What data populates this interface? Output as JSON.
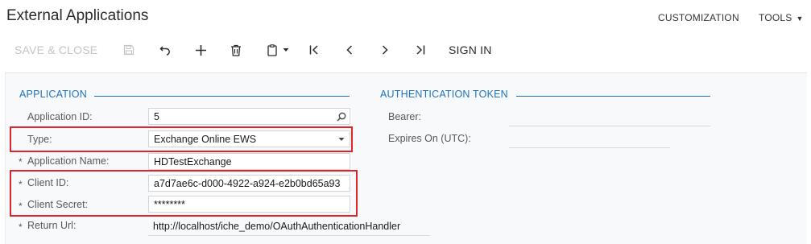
{
  "header": {
    "title": "External Applications",
    "customization_label": "CUSTOMIZATION",
    "tools_label": "TOOLS",
    "tools_caret": "▼"
  },
  "toolbar": {
    "save_close_label": "SAVE & CLOSE",
    "sign_in_label": "SIGN IN",
    "icons": [
      "save-icon",
      "undo-icon",
      "add-icon",
      "delete-icon",
      "copy-paste-icon",
      "first-record-icon",
      "previous-record-icon",
      "next-record-icon",
      "last-record-icon"
    ]
  },
  "application": {
    "section_title": "APPLICATION",
    "application_id": {
      "label": "Application ID:",
      "value": "5"
    },
    "type": {
      "label": "Type:",
      "value": "Exchange Online EWS"
    },
    "application_name": {
      "label": "Application Name:",
      "value": "HDTestExchange"
    },
    "client_id": {
      "label": "Client ID:",
      "value": "a7d7ae6c-d000-4922-a924-e2b0bd65a93"
    },
    "client_secret": {
      "label": "Client Secret:",
      "value": "********"
    },
    "return_url": {
      "label": "Return Url:",
      "value": "http://localhost/iche_demo/OAuthAuthenticationHandler"
    },
    "required_mark": "*"
  },
  "authentication_token": {
    "section_title": "AUTHENTICATION TOKEN",
    "bearer_label": "Bearer:",
    "bearer_value": "",
    "expires_label": "Expires On (UTC):",
    "expires_value": ""
  },
  "colors": {
    "accent": "#1f72b8",
    "highlight": "#e0242b",
    "disabled": "#c4c4c4"
  }
}
